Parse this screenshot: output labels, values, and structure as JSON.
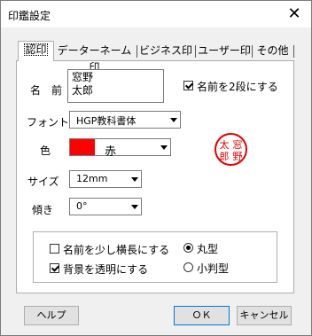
{
  "window": {
    "title": "印鑑設定",
    "close_glyph": "✕"
  },
  "tabs": [
    {
      "label": "認印"
    },
    {
      "label": "データーネーム印"
    },
    {
      "label": "ビジネス印"
    },
    {
      "label": "ユーザー印"
    },
    {
      "label": "その他"
    }
  ],
  "form": {
    "name_label": "名　前",
    "name_line1": "窓野",
    "name_line2": "太郎",
    "two_line_label": "名前を2段にする",
    "two_line_checked": true,
    "font_label": "フォント",
    "font_value": "HGP教科書体",
    "color_label": "色",
    "color_value": "赤",
    "color_hex": "#ff0000",
    "size_label": "サイズ",
    "size_value": "12mm",
    "tilt_label": "傾き",
    "tilt_value": "0°"
  },
  "preview": {
    "chars": [
      "太",
      "窓",
      "郎",
      "野"
    ],
    "ink_color": "#e00000"
  },
  "options": {
    "stretch_label": "名前を少し横長にする",
    "stretch_checked": false,
    "transparent_label": "背景を透明にする",
    "transparent_checked": true,
    "round_label": "丸型",
    "round_selected": true,
    "oval_label": "小判型",
    "oval_selected": false
  },
  "buttons": {
    "help": "ヘルプ",
    "ok": "ＯＫ",
    "cancel": "キャンセル"
  }
}
